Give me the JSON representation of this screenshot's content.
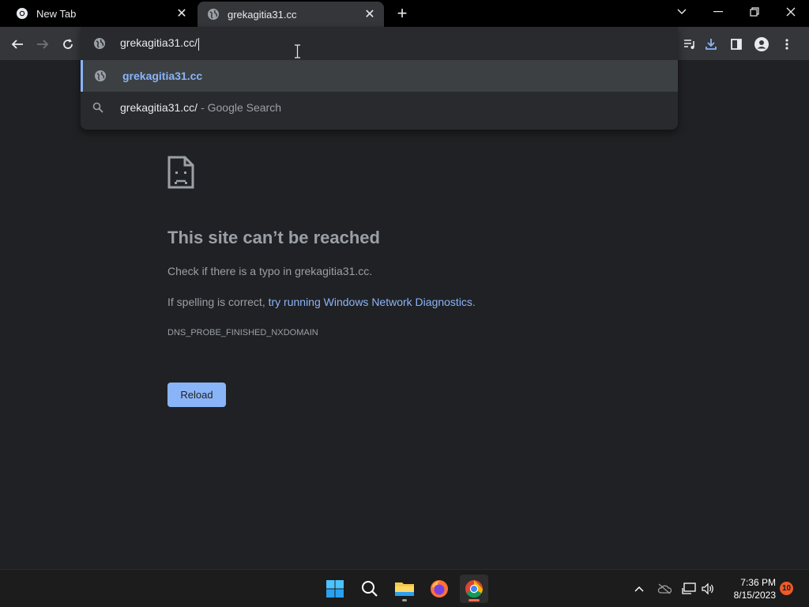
{
  "tabs": [
    {
      "title": "New Tab",
      "icon": "chrome-icon"
    },
    {
      "title": "grekagitia31.cc",
      "icon": "globe-icon"
    }
  ],
  "omnibox": {
    "value": "grekagitia31.cc/",
    "suggestions": [
      {
        "text": "grekagitia31.cc",
        "icon": "globe-icon"
      },
      {
        "text": "grekagitia31.cc/",
        "secondary": "- Google Search",
        "icon": "search-icon"
      }
    ]
  },
  "error": {
    "title": "This site can’t be reached",
    "line1": "Check if there is a typo in grekagitia31.cc.",
    "line2_prefix": "If spelling is correct, ",
    "line2_link": "try running Windows Network Diagnostics",
    "line2_suffix": ".",
    "code": "DNS_PROBE_FINISHED_NXDOMAIN",
    "reload_label": "Reload"
  },
  "taskbar": {
    "time": "7:36 PM",
    "date": "8/15/2023",
    "notification_count": "10"
  },
  "colors": {
    "accent": "#8ab4f8",
    "background": "#202124",
    "toolbar": "#35363a"
  }
}
